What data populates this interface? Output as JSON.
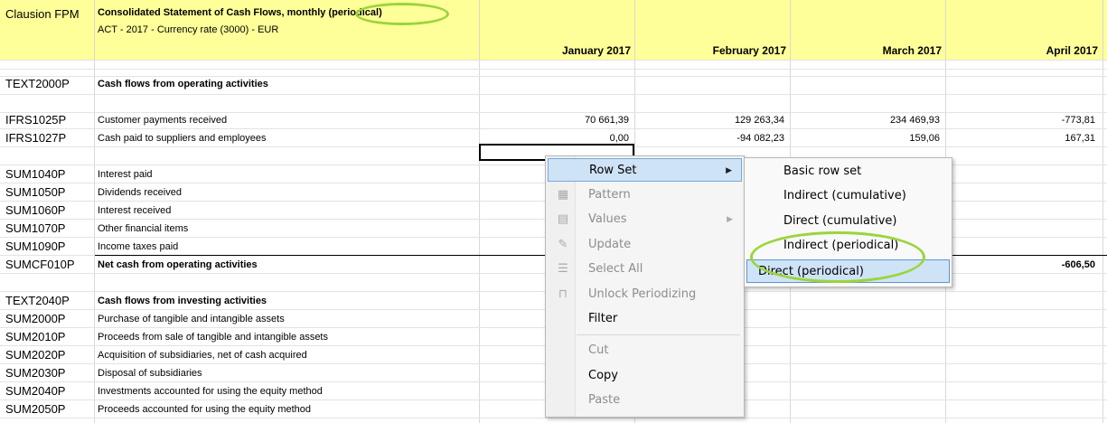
{
  "app_name": "Clausion FPM",
  "report": {
    "title": "Consolidated Statement of Cash Flows, monthly (periodical)",
    "subtitle": "ACT - 2017 - Currency rate (3000) - EUR"
  },
  "columns": [
    "January 2017",
    "February 2017",
    "March 2017",
    "April 2017"
  ],
  "rows": [
    {
      "code": "TEXT2000P",
      "label": "Cash flows from operating activities",
      "values": [
        "",
        "",
        "",
        ""
      ]
    },
    {
      "code": "IFRS1025P",
      "label": "Customer payments received",
      "values": [
        "70 661,39",
        "129 263,34",
        "234 469,93",
        "-773,81"
      ]
    },
    {
      "code": "IFRS1027P",
      "label": "Cash paid to suppliers and employees",
      "values": [
        "0,00",
        "-94 082,23",
        "159,06",
        "167,31"
      ]
    },
    {
      "code": "SUM1040P",
      "label": "Interest paid",
      "values": [
        "",
        "",
        "",
        ""
      ]
    },
    {
      "code": "SUM1050P",
      "label": "Dividends received",
      "values": [
        "",
        "",
        "",
        ""
      ]
    },
    {
      "code": "SUM1060P",
      "label": "Interest received",
      "values": [
        "",
        "",
        "",
        ""
      ]
    },
    {
      "code": "SUM1070P",
      "label": "Other financial items",
      "values": [
        "",
        "",
        "",
        ""
      ]
    },
    {
      "code": "SUM1090P",
      "label": "Income taxes paid",
      "values": [
        "",
        "",
        "",
        ""
      ]
    },
    {
      "code": "SUMCF010P",
      "label": "Net cash from operating activities",
      "values": [
        "",
        "",
        "",
        "-606,50"
      ]
    },
    {
      "code": "TEXT2040P",
      "label": "Cash flows from investing activities",
      "values": [
        "",
        "",
        "",
        ""
      ]
    },
    {
      "code": "SUM2000P",
      "label": "Purchase of tangible and intangible assets",
      "values": [
        "",
        "",
        "",
        ""
      ]
    },
    {
      "code": "SUM2010P",
      "label": "Proceeds from sale of tangible and intangible assets",
      "values": [
        "",
        "",
        "",
        ""
      ]
    },
    {
      "code": "SUM2020P",
      "label": "Acquisition of subsidiaries, net of cash acquired",
      "values": [
        "",
        "",
        "",
        ""
      ]
    },
    {
      "code": "SUM2030P",
      "label": "Disposal of subsidiaries",
      "values": [
        "",
        "",
        "",
        ""
      ]
    },
    {
      "code": "SUM2040P",
      "label": "Investments accounted for using the equity method",
      "values": [
        "",
        "",
        "",
        ""
      ]
    },
    {
      "code": "SUM2050P",
      "label": "Proceeds accounted for using the equity method",
      "values": [
        "",
        "",
        "",
        ""
      ]
    }
  ],
  "context_menu": {
    "items": [
      "Row Set",
      "Pattern",
      "Values",
      "Update",
      "Select All",
      "Unlock Periodizing",
      "Filter",
      "Cut",
      "Copy",
      "Paste"
    ]
  },
  "submenu": {
    "items": [
      "Basic row set",
      "Indirect (cumulative)",
      "Direct (cumulative)",
      "Indirect (periodical)",
      "Direct (periodical)"
    ]
  },
  "colors": {
    "header_bg": "#ffff99",
    "highlight_ellipse": "#9ad53a",
    "menu_hover": "#cfe3f7"
  },
  "icons": [
    "pattern-icon",
    "values-icon",
    "update-icon",
    "select-all-icon",
    "unlock-icon",
    "submenu-arrow-icon"
  ]
}
